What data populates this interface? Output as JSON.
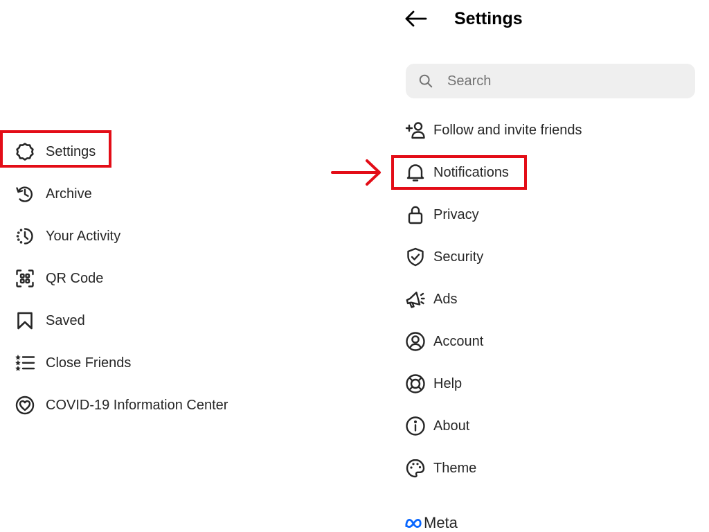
{
  "left_menu": {
    "items": [
      {
        "label": "Settings",
        "icon": "gear-icon"
      },
      {
        "label": "Archive",
        "icon": "archive-clock-icon"
      },
      {
        "label": "Your Activity",
        "icon": "activity-clock-icon"
      },
      {
        "label": "QR Code",
        "icon": "qr-code-icon"
      },
      {
        "label": "Saved",
        "icon": "bookmark-icon"
      },
      {
        "label": "Close Friends",
        "icon": "star-list-icon"
      },
      {
        "label": "COVID-19 Information Center",
        "icon": "heart-circle-icon"
      }
    ]
  },
  "settings_panel": {
    "title": "Settings",
    "search": {
      "placeholder": "Search",
      "value": ""
    },
    "items": [
      {
        "label": "Follow and invite friends",
        "icon": "add-person-icon"
      },
      {
        "label": "Notifications",
        "icon": "bell-icon"
      },
      {
        "label": "Privacy",
        "icon": "lock-icon"
      },
      {
        "label": "Security",
        "icon": "shield-check-icon"
      },
      {
        "label": "Ads",
        "icon": "megaphone-icon"
      },
      {
        "label": "Account",
        "icon": "user-circle-icon"
      },
      {
        "label": "Help",
        "icon": "lifebuoy-icon"
      },
      {
        "label": "About",
        "icon": "info-icon"
      },
      {
        "label": "Theme",
        "icon": "palette-icon"
      }
    ],
    "footer_brand": "Meta"
  },
  "annotations": {
    "highlight_color": "#e30d17",
    "highlighted_items": [
      "Settings",
      "Notifications"
    ],
    "arrow_icon": "right-arrow-icon"
  }
}
